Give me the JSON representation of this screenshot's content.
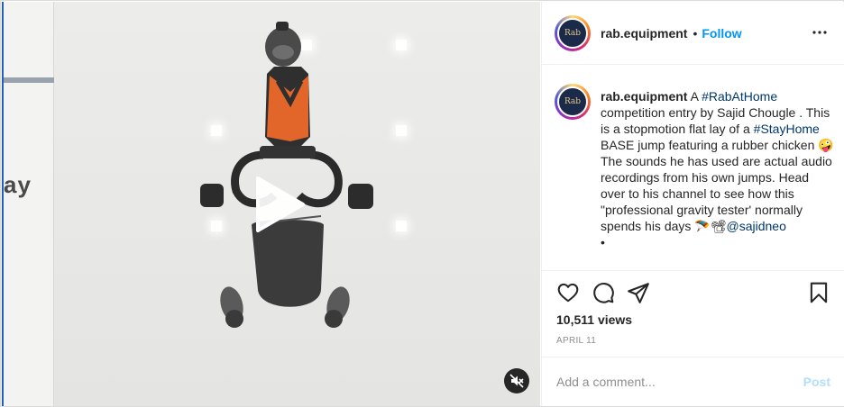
{
  "post": {
    "username": "rab.equipment",
    "follow_label": "Follow",
    "dot": "•",
    "avatar_text": "Rab"
  },
  "media": {
    "wall_text": "ay",
    "play_icon": "play-icon",
    "mute_icon": "speaker-muted-icon"
  },
  "caption": {
    "username": "rab.equipment",
    "intro": "A",
    "hashtag1": "#RabAtHome",
    "part1": "competition entry by Sajid Chougle . This is a stopmotion flat lay of a",
    "hashtag2": "#StayHome",
    "part2": "BASE jump featuring a rubber chicken 🤪The sounds he has used are actual audio recordings from his own jumps. Head over to his channel to see how this \"professional gravity tester' normally spends his days 🪂📽",
    "mention": "@sajidneo",
    "bullet": "•"
  },
  "stats": {
    "views": "10,511 views",
    "date": "April 11"
  },
  "comment": {
    "placeholder": "Add a comment...",
    "post_label": "Post"
  },
  "colors": {
    "accent": "#0095f6",
    "link": "#00376b",
    "post_disabled": "#b2dffc"
  },
  "icons": [
    "heart-icon",
    "comment-icon",
    "share-icon",
    "bookmark-icon",
    "more-icon"
  ]
}
